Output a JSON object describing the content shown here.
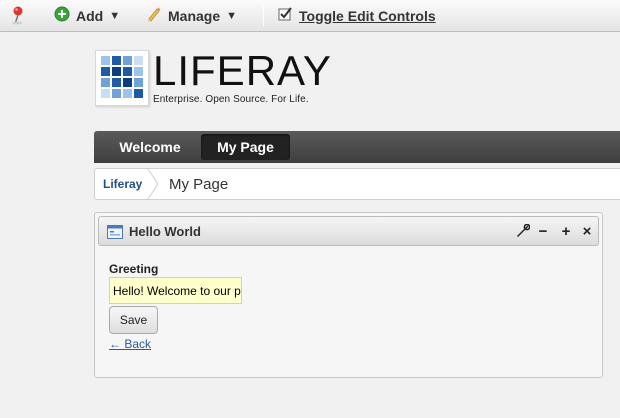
{
  "dockbar": {
    "pin_icon": "pushpin-icon",
    "add": {
      "label": "Add",
      "icon": "plus-circle-icon"
    },
    "manage": {
      "label": "Manage",
      "icon": "pencil-icon"
    },
    "toggle": {
      "label": "Toggle Edit Controls",
      "icon": "checkbox-checked-icon"
    },
    "caret": "▼"
  },
  "logo": {
    "wordmark": "LIFERAY",
    "tagline": "Enterprise. Open Source. For Life."
  },
  "navigation": {
    "tabs": [
      {
        "label": "Welcome",
        "selected": false
      },
      {
        "label": "My Page",
        "selected": true
      }
    ]
  },
  "breadcrumb": {
    "items": [
      "Liferay",
      "My Page"
    ]
  },
  "portlet": {
    "title": "Hello World",
    "controls": {
      "wrench": "wrench-icon",
      "minimize": "−",
      "maximize": "+",
      "close": "×"
    },
    "form": {
      "greeting_label": "Greeting",
      "greeting_value": "Hello! Welcome to our p",
      "save_label": "Save",
      "back_label": "← Back"
    }
  },
  "colors": {
    "nav_bg": "#4a4a4a",
    "nav_selected": "#222222",
    "link": "#2a5aa0",
    "input_highlight": "#ffffcc",
    "add_icon": "#3aa43a"
  }
}
